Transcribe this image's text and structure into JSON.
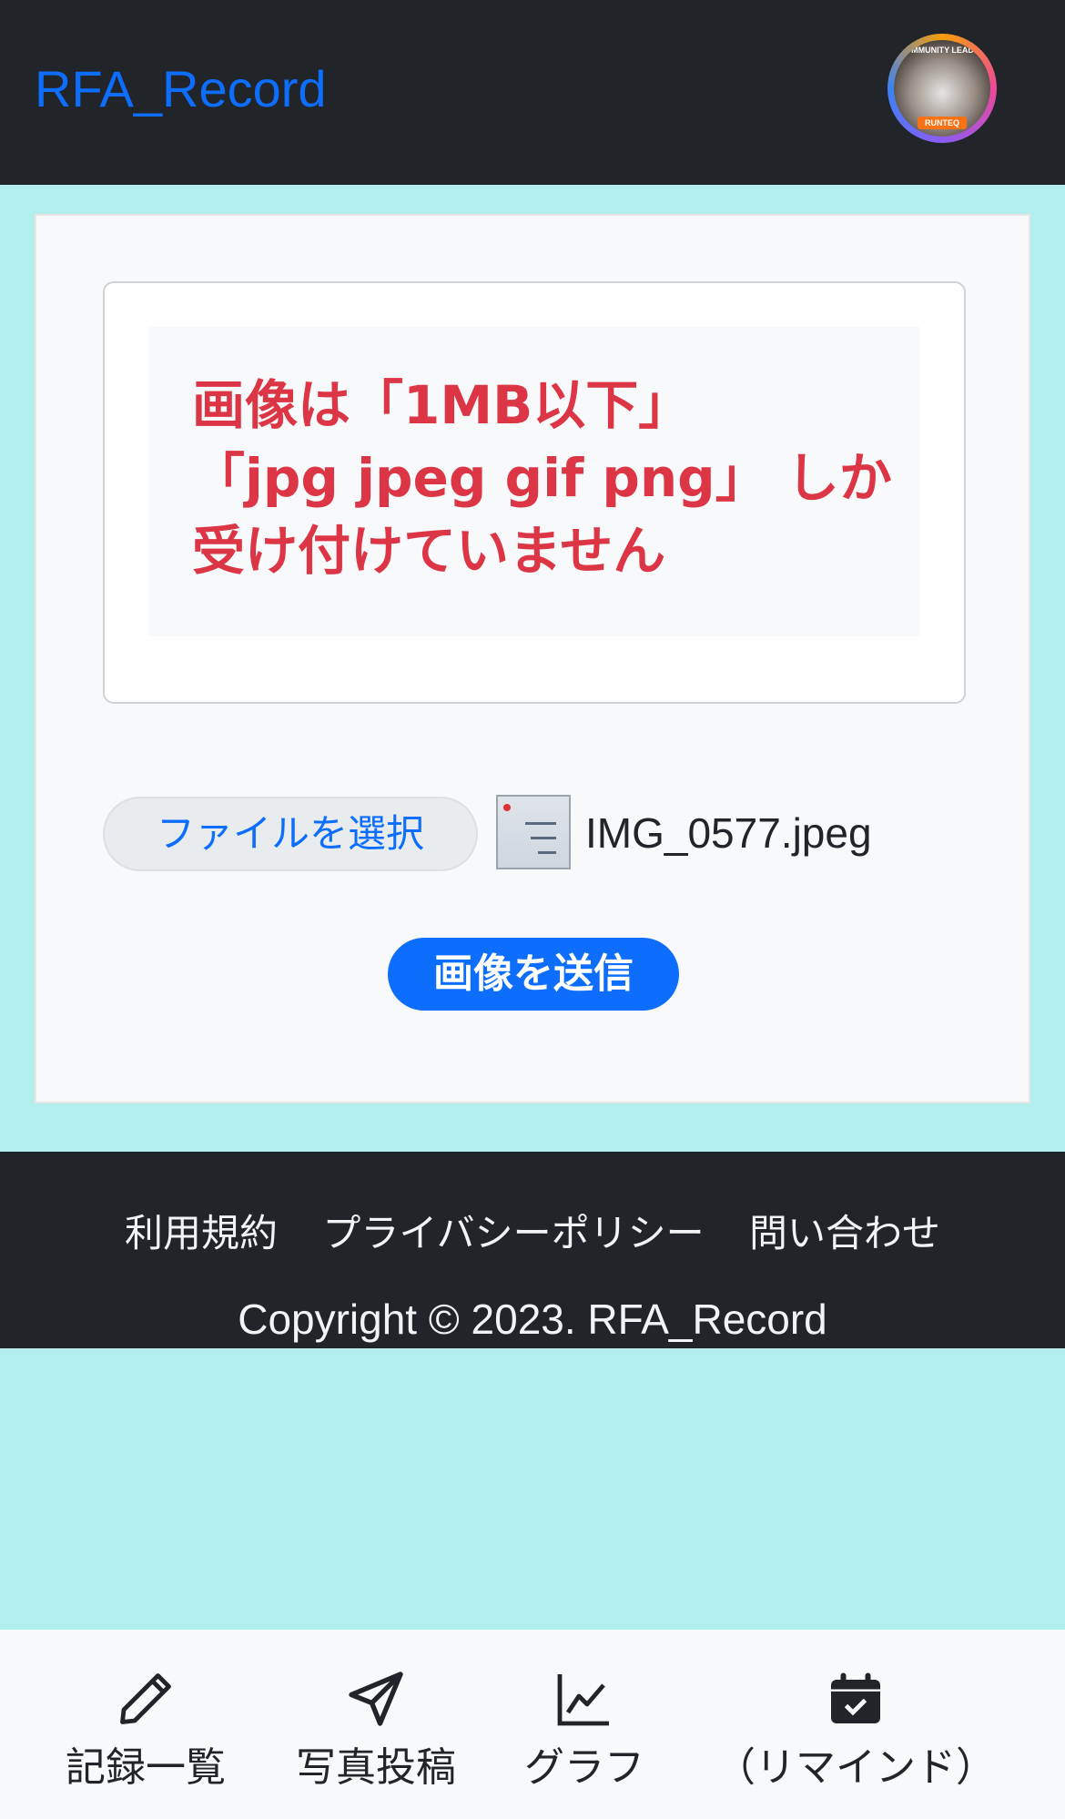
{
  "header": {
    "brand": "RFA_Record",
    "avatar": {
      "ring_text": "COMMUNITY LEADER",
      "badge_text": "RUNTEQ"
    }
  },
  "notice": {
    "lines": [
      "画像は「1MB以下」",
      "「jpg jpeg gif png」 しか",
      "受け付けていません"
    ]
  },
  "upload": {
    "choose_label": "ファイルを選択",
    "file_name": "IMG_0577.jpeg",
    "submit_label": "画像を送信"
  },
  "footer": {
    "links": [
      "利用規約",
      "プライバシーポリシー",
      "問い合わせ"
    ],
    "copyright": "Copyright © 2023. RFA_Record"
  },
  "bottom_nav": {
    "items": [
      {
        "label": "記録一覧",
        "icon": "pencil-icon"
      },
      {
        "label": "写真投稿",
        "icon": "send-icon"
      },
      {
        "label": "グラフ",
        "icon": "chart-line-icon"
      },
      {
        "label": "（リマインド）",
        "icon": "calendar-check-icon"
      }
    ]
  },
  "colors": {
    "page_background": "#b2eeeb",
    "header_background": "#212529",
    "accent": "#0d6efd",
    "warning_text": "#dc3545"
  }
}
